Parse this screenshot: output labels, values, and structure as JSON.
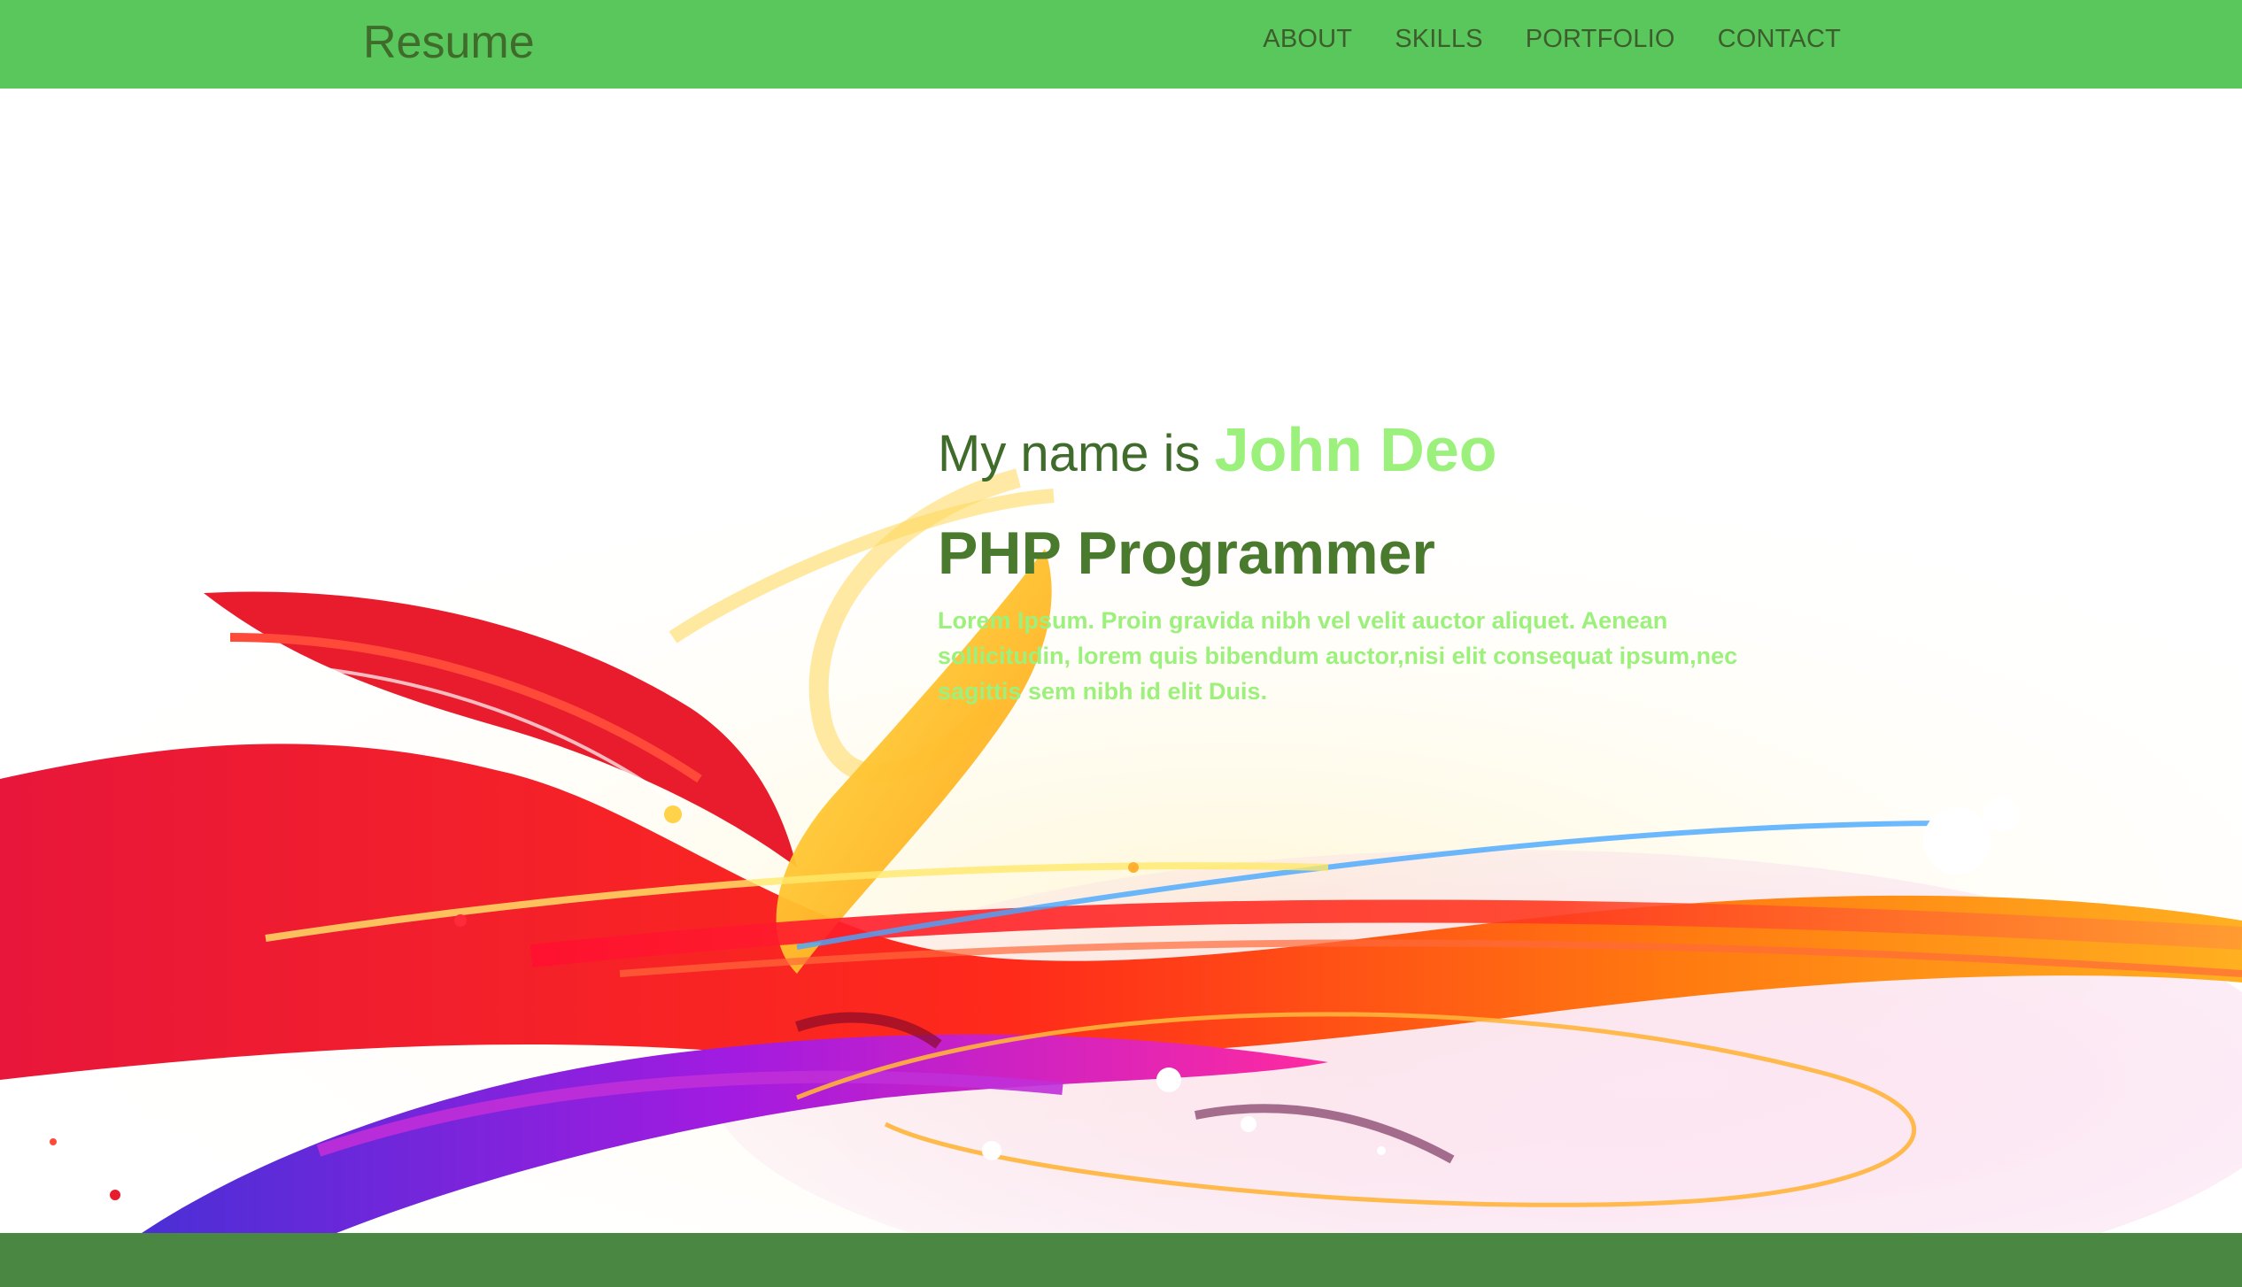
{
  "header": {
    "brand": "Resume",
    "nav": {
      "about": "ABOUT",
      "skills": "SKILLS",
      "portfolio": "PORTFOLIO",
      "contact": "CONTACT"
    }
  },
  "hero": {
    "greeting_prefix": "My name is",
    "name": "John Deo",
    "role": "PHP Programmer",
    "bio": "Lorem Ipsum. Proin gravida nibh vel velit auctor aliquet. Aenean sollicitudin, lorem quis bibendum auctor,nisi elit consequat ipsum,nec sagittis sem nibh id elit Duis."
  },
  "colors": {
    "header_bg": "#5ac75c",
    "brand_text": "#3f6b2b",
    "nav_text": "#3d5d2d",
    "name_accent": "#9cf07c",
    "role_text": "#4a7a2e",
    "footer_bg": "#4a8742"
  },
  "icons": {
    "hero_background": "paint-splash-art"
  }
}
